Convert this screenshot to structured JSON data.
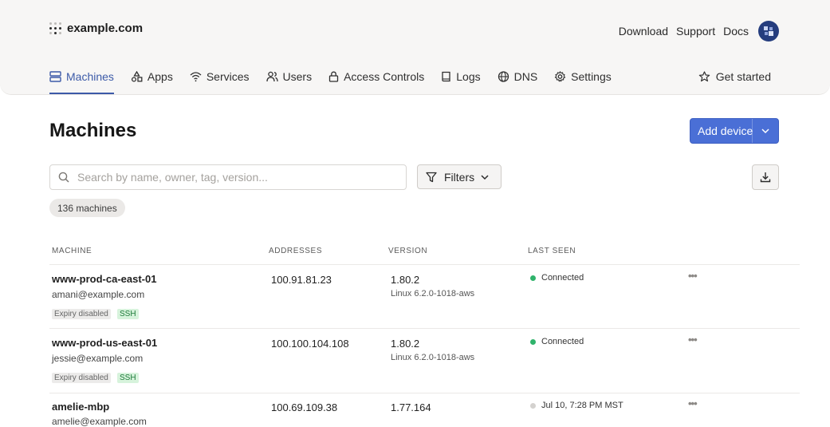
{
  "brand": {
    "name": "example.com"
  },
  "toplinks": [
    "Download",
    "Support",
    "Docs"
  ],
  "nav": [
    {
      "label": "Machines",
      "icon": "machines-icon",
      "active": true
    },
    {
      "label": "Apps",
      "icon": "apps-icon"
    },
    {
      "label": "Services",
      "icon": "wifi-icon"
    },
    {
      "label": "Users",
      "icon": "users-icon"
    },
    {
      "label": "Access Controls",
      "icon": "lock-icon"
    },
    {
      "label": "Logs",
      "icon": "book-icon"
    },
    {
      "label": "DNS",
      "icon": "globe-icon"
    },
    {
      "label": "Settings",
      "icon": "gear-icon"
    }
  ],
  "get_started": "Get started",
  "page": {
    "title": "Machines",
    "add_button": "Add device",
    "search_placeholder": "Search by name, owner, tag, version...",
    "filters_label": "Filters",
    "count": "136 machines"
  },
  "table": {
    "headers": [
      "MACHINE",
      "ADDRESSES",
      "VERSION",
      "LAST SEEN"
    ],
    "rows": [
      {
        "name": "www-prod-ca-east-01",
        "owner": "amani@example.com",
        "tags": [
          "Expiry disabled",
          "SSH"
        ],
        "address": "100.91.81.23",
        "version": "1.80.2",
        "os": "Linux 6.2.0-1018-aws",
        "status": "Connected",
        "online": true
      },
      {
        "name": "www-prod-us-east-01",
        "owner": "jessie@example.com",
        "tags": [
          "Expiry disabled",
          "SSH"
        ],
        "address": "100.100.104.108",
        "version": "1.80.2",
        "os": "Linux 6.2.0-1018-aws",
        "status": "Connected",
        "online": true
      },
      {
        "name": "amelie-mbp",
        "owner": "amelie@example.com",
        "tags": [],
        "address": "100.69.109.38",
        "version": "1.77.164",
        "os": "",
        "status": "Jul 10, 7:28 PM MST",
        "online": false
      }
    ],
    "more_glyph": "•••"
  },
  "colors": {
    "accent": "#3c5aa8",
    "button": "#4a6fd6",
    "online": "#2fb36b",
    "offline": "#d4d2cf"
  }
}
